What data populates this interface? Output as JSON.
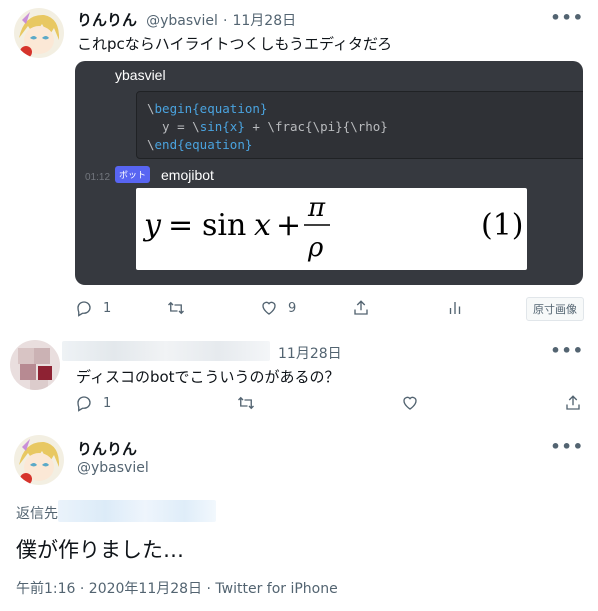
{
  "tweets": [
    {
      "display_name": "りんりん",
      "handle": "@ybasviel",
      "separator": "·",
      "date": "11月28日",
      "text": "これpcならハイライトつくしもうエディタだろ",
      "more": "•••",
      "embed": {
        "user": "ybasviel",
        "code_lines": [
          {
            "prefix": "\\",
            "kw": "begin{equation}",
            "rest": ""
          },
          {
            "prefix": "  y = \\",
            "kw": "sin{x}",
            "rest": " + \\frac{\\pi}{\\rho}"
          },
          {
            "prefix": "\\",
            "kw": "end{equation}",
            "rest": ""
          }
        ],
        "time": "01:12",
        "bot_badge": "ボット",
        "bot_name": "emojibot",
        "formula_number": "(1)"
      },
      "actions": {
        "reply_count": "1",
        "like_count": "9",
        "original_image_label": "原寸画像"
      }
    },
    {
      "date": "11月28日",
      "text": "ディスコのbotでこういうのがあるの？",
      "more": "•••",
      "actions": {
        "reply_count": "1"
      }
    },
    {
      "display_name": "りんりん",
      "handle": "@ybasviel",
      "more": "•••",
      "reply_prefix": "返信先",
      "text": "僕が作りました…",
      "meta": "午前1:16 · 2020年11月28日 · Twitter for iPhone"
    }
  ],
  "colors": {
    "accent": "#1d9bf0",
    "muted": "#536471",
    "line": "#cfd9de",
    "discord_bg": "#36393f",
    "bot_badge": "#5865f2"
  }
}
